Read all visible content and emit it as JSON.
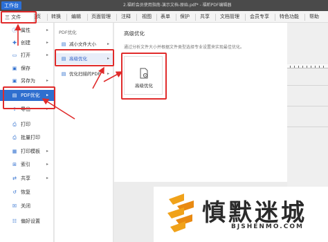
{
  "titlebar": {
    "workbench_label": "工作台",
    "title": "2.福昕会员使用指南-演示文档-原始.pdf* - 福昕PDF编辑器"
  },
  "menubar": {
    "file_label": "三 文件",
    "items": [
      "主页",
      "转换",
      "编辑",
      "页面管理",
      "注释",
      "视图",
      "表单",
      "保护",
      "共享",
      "文档管理",
      "会员专享",
      "特色功能",
      "帮助"
    ]
  },
  "file_panel": {
    "items": [
      {
        "label": "属性",
        "icon": "info-icon",
        "arrow": "▸"
      },
      {
        "label": "创建",
        "icon": "create-icon",
        "arrow": "▸"
      },
      {
        "label": "打开",
        "icon": "open-folder-icon",
        "arrow": "▸"
      },
      {
        "label": "保存",
        "icon": "save-icon",
        "arrow": ""
      },
      {
        "label": "另存为",
        "icon": "save-as-icon",
        "arrow": "▸"
      },
      {
        "label": "PDF优化",
        "icon": "pdf-optimize-icon",
        "arrow": "▸"
      },
      {
        "label": "导出",
        "icon": "export-icon",
        "arrow": "▸"
      },
      {
        "label": "打印",
        "icon": "print-icon",
        "arrow": ""
      },
      {
        "label": "批量打印",
        "icon": "batch-print-icon",
        "arrow": ""
      },
      {
        "label": "打印模板",
        "icon": "print-template-icon",
        "arrow": "▸"
      },
      {
        "label": "索引",
        "icon": "index-icon",
        "arrow": "▸"
      },
      {
        "label": "共享",
        "icon": "share-icon",
        "arrow": "▸"
      },
      {
        "label": "恢复",
        "icon": "restore-icon",
        "arrow": ""
      },
      {
        "label": "关闭",
        "icon": "close-doc-icon",
        "arrow": ""
      },
      {
        "label": "偏好设置",
        "icon": "preferences-icon",
        "arrow": ""
      }
    ]
  },
  "pdf_optimize": {
    "header": "PDF优化",
    "items": [
      {
        "label": "减小文件大小",
        "arrow": "▸"
      },
      {
        "label": "高级优化",
        "arrow": "▸"
      },
      {
        "label": "优化扫描的PDF",
        "arrow": "▸"
      }
    ]
  },
  "advanced": {
    "title": "高级优化",
    "description": "通过分析文件大小并根据文件类型选择专业设置来实现最佳优化。",
    "card_label": "高级优化"
  },
  "watermark": {
    "title": "慎默迷城",
    "url": "BJSHENMO.COM"
  },
  "colors": {
    "accent": "#2f6fcf",
    "highlight_box": "#e02a2a"
  }
}
